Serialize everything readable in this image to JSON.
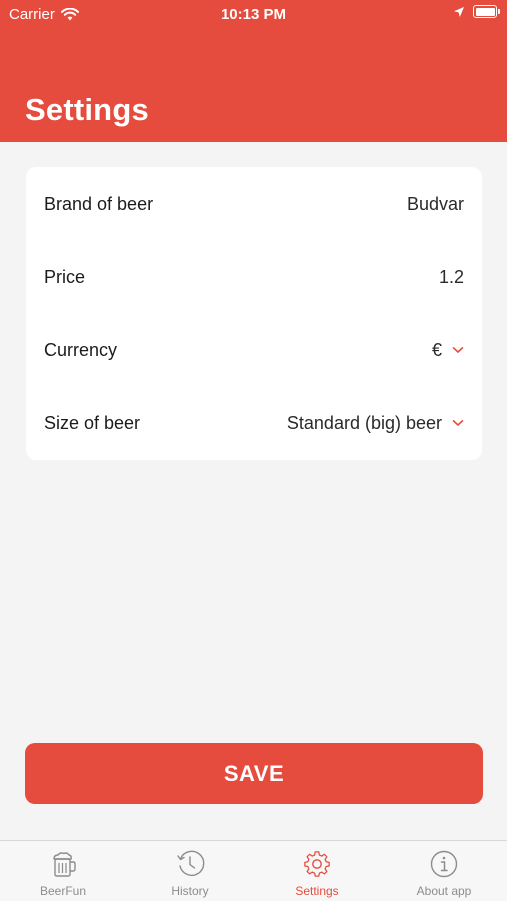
{
  "status_bar": {
    "carrier": "Carrier",
    "time": "10:13 PM"
  },
  "header": {
    "title": "Settings",
    "background_color": "#e54c3d"
  },
  "settings": {
    "rows": [
      {
        "label": "Brand of beer",
        "value": "Budvar",
        "has_dropdown": false
      },
      {
        "label": "Price",
        "value": "1.2",
        "has_dropdown": false
      },
      {
        "label": "Currency",
        "value": "€",
        "has_dropdown": true
      },
      {
        "label": "Size of beer",
        "value": "Standard (big) beer",
        "has_dropdown": true
      }
    ]
  },
  "save_button": {
    "label": "SAVE"
  },
  "tabbar": {
    "tabs": [
      {
        "label": "BeerFun",
        "icon": "beer-mug-icon",
        "active": false
      },
      {
        "label": "History",
        "icon": "history-clock-icon",
        "active": false
      },
      {
        "label": "Settings",
        "icon": "gear-icon",
        "active": true
      },
      {
        "label": "About app",
        "icon": "info-icon",
        "active": false
      }
    ]
  },
  "colors": {
    "accent": "#e54c3d",
    "background": "#f4f4f4",
    "inactive_tab": "#8c8c8c"
  }
}
